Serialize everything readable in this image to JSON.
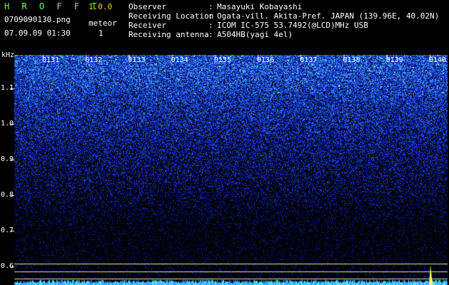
{
  "header": {
    "brand": "H R O F F T",
    "version": "1.0.0",
    "filename": "0709090130.png",
    "meteor_label": "meteor",
    "datetime": "07.09.09 01:30",
    "meteor_count": "1",
    "info": [
      {
        "label": "Observer",
        "value": "Masayuki Kobayashi"
      },
      {
        "label": "Receiving Location",
        "value": "Ogata-vill. Akita-Pref. JAPAN (139.96E, 40.02N)"
      },
      {
        "label": "Receiver",
        "value": "ICOM IC-575 53.7492(@LCD)MHz USB"
      },
      {
        "label": "Receiving antenna",
        "value": "A504HB(yagi 4el)"
      }
    ],
    "separator": ":"
  },
  "chart_data": {
    "type": "heatmap",
    "ylabel": "kHz",
    "x_ticks": [
      "0131",
      "0132",
      "0133",
      "0134",
      "0135",
      "0136",
      "0137",
      "0138",
      "0139",
      "0140"
    ],
    "y_ticks": [
      "1.1",
      "1.0",
      "0.9",
      "0.8",
      "0.7",
      "0.6"
    ],
    "ylim": [
      0.56,
      1.19
    ],
    "colors": {
      "background": "#000000",
      "low": "#0a1a8a",
      "mid": "#2a55ff",
      "high": "#55ddff",
      "peak": "#ffff66",
      "hline": "#e8e0a0"
    }
  }
}
